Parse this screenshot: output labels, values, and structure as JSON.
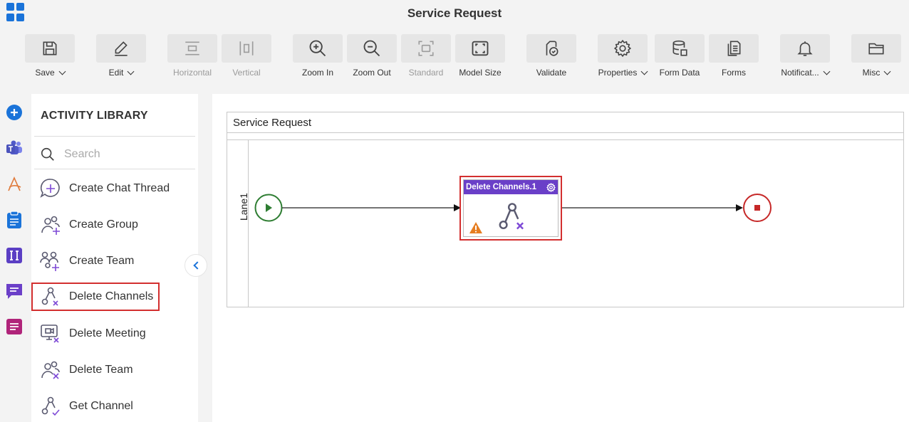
{
  "window": {
    "title": "Service Request"
  },
  "toolbar": {
    "save": "Save",
    "edit": "Edit",
    "horizontal": "Horizontal",
    "vertical": "Vertical",
    "zoom_in": "Zoom In",
    "zoom_out": "Zoom Out",
    "standard": "Standard",
    "model_size": "Model Size",
    "validate": "Validate",
    "properties": "Properties",
    "form_data": "Form Data",
    "forms": "Forms",
    "notifications": "Notificat...",
    "misc": "Misc"
  },
  "library": {
    "title": "ACTIVITY LIBRARY",
    "search_placeholder": "Search",
    "items": [
      {
        "label": "Create Chat Thread",
        "icon": "chat-plus-icon"
      },
      {
        "label": "Create Group",
        "icon": "group-plus-icon"
      },
      {
        "label": "Create Team",
        "icon": "team-plus-icon"
      },
      {
        "label": "Delete Channels",
        "icon": "channels-delete-icon",
        "selected": true
      },
      {
        "label": "Delete Meeting",
        "icon": "meeting-delete-icon"
      },
      {
        "label": "Delete Team",
        "icon": "team-delete-icon"
      },
      {
        "label": "Get Channel",
        "icon": "channel-check-icon"
      }
    ]
  },
  "canvas": {
    "pool_title": "Service Request",
    "lane_label": "Lane1",
    "activity_node": {
      "title": "Delete Channels.1",
      "status": "warning"
    }
  },
  "colors": {
    "accent_blue": "#1a73d9",
    "activity_header": "#6a3fc8",
    "selection_red": "#d32f2f",
    "start_green": "#2e7d32",
    "end_red": "#c62828",
    "warning_orange": "#e67e22"
  }
}
